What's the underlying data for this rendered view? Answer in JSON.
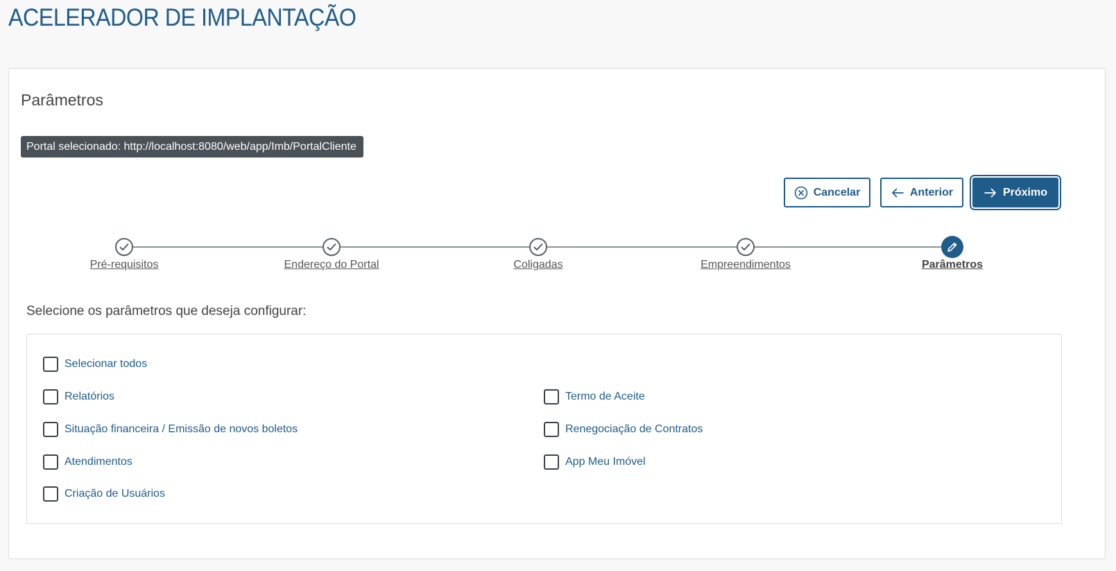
{
  "page": {
    "title": "ACELERADOR DE IMPLANTAÇÃO"
  },
  "section": {
    "title": "Parâmetros",
    "portal_badge": "Portal selecionado: http://localhost:8080/web/app/Imb/PortalCliente"
  },
  "actions": {
    "cancel_label": "Cancelar",
    "previous_label": "Anterior",
    "next_label": "Próximo"
  },
  "stepper": {
    "steps": [
      {
        "label": "Pré-requisitos",
        "state": "completed"
      },
      {
        "label": "Endereço do Portal",
        "state": "completed"
      },
      {
        "label": "Coligadas",
        "state": "completed"
      },
      {
        "label": "Empreendimentos",
        "state": "completed"
      },
      {
        "label": "Parâmetros",
        "state": "active"
      }
    ]
  },
  "parameters": {
    "prompt": "Selecione os parâmetros que deseja configurar:",
    "select_all": "Selecionar todos",
    "left_column": [
      {
        "label": "Relatórios",
        "checked": false
      },
      {
        "label": "Situação financeira / Emissão de novos boletos",
        "checked": false
      },
      {
        "label": "Atendimentos",
        "checked": false
      },
      {
        "label": "Criação de Usuários",
        "checked": false
      }
    ],
    "right_column": [
      {
        "label": "Termo de Aceite",
        "checked": false
      },
      {
        "label": "Renegociação de Contratos",
        "checked": false
      },
      {
        "label": "App Meu Imóvel",
        "checked": false
      }
    ]
  },
  "colors": {
    "primary": "#1f5c8a",
    "badge_bg": "#4a5157",
    "text": "#444444"
  },
  "icons": {
    "cancel": "circle-x-icon",
    "previous": "arrow-left-icon",
    "next": "arrow-right-icon",
    "step_done": "check-circle-icon",
    "step_active": "pencil-icon"
  }
}
